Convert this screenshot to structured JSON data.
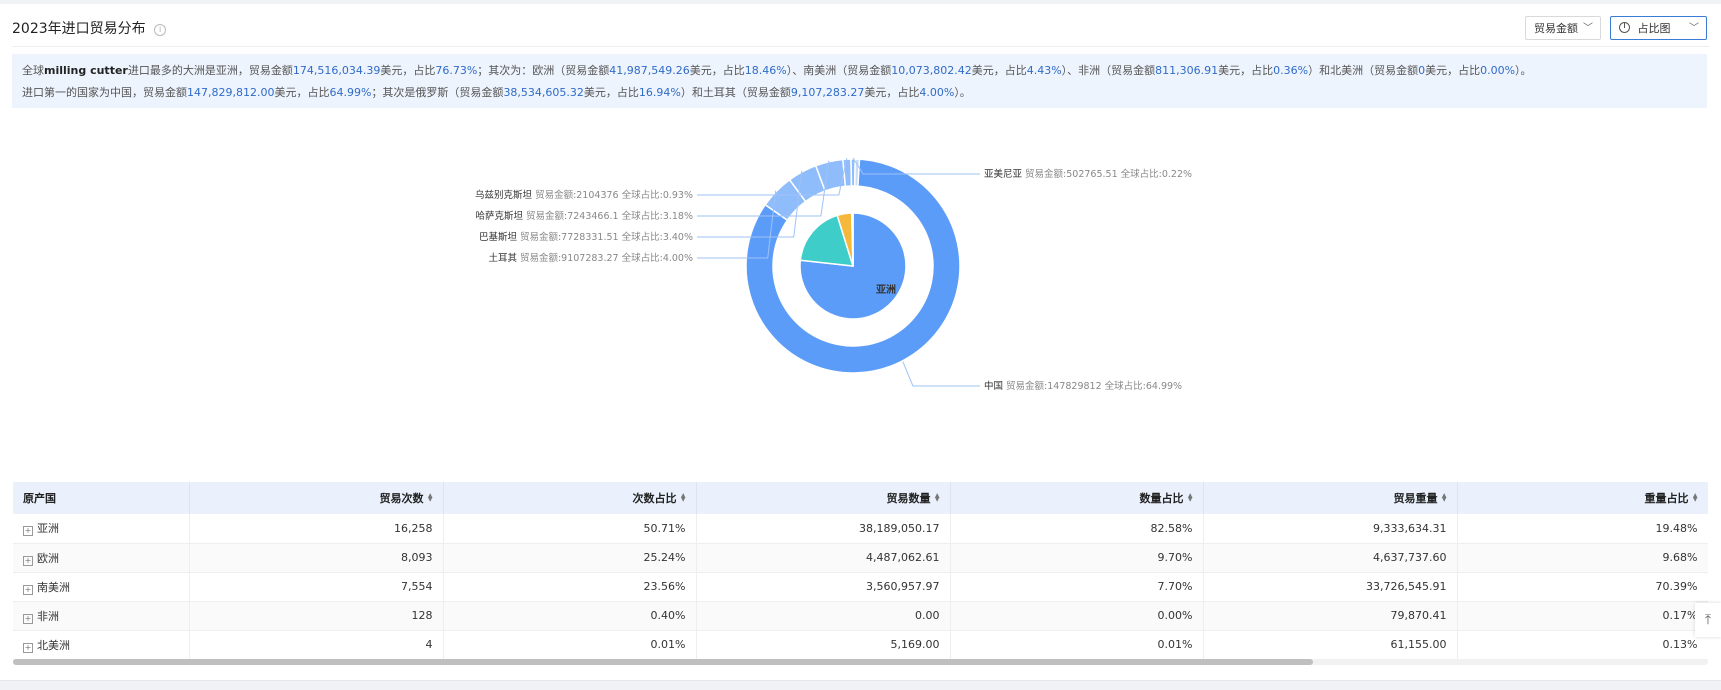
{
  "header": {
    "title": "2023年进口贸易分布",
    "metric_select": "贸易金额",
    "view_select": "占比图"
  },
  "summary": {
    "line1": [
      {
        "t": "全球",
        "c": ""
      },
      {
        "t": "milling cutter",
        "c": "b"
      },
      {
        "t": "进口最多的大洲是亚洲，贸易金额",
        "c": ""
      },
      {
        "t": "174,516,034.39",
        "c": "hl"
      },
      {
        "t": "美元，占比",
        "c": ""
      },
      {
        "t": "76.73%",
        "c": "hl"
      },
      {
        "t": "；其次为：欧洲（贸易金额",
        "c": ""
      },
      {
        "t": "41,987,549.26",
        "c": "hl"
      },
      {
        "t": "美元，占比",
        "c": ""
      },
      {
        "t": "18.46%",
        "c": "hl"
      },
      {
        "t": "）、南美洲（贸易金额",
        "c": ""
      },
      {
        "t": "10,073,802.42",
        "c": "hl"
      },
      {
        "t": "美元，占比",
        "c": ""
      },
      {
        "t": "4.43%",
        "c": "hl"
      },
      {
        "t": "）、非洲（贸易金额",
        "c": ""
      },
      {
        "t": "811,306.91",
        "c": "hl"
      },
      {
        "t": "美元，占比",
        "c": ""
      },
      {
        "t": "0.36%",
        "c": "hl"
      },
      {
        "t": "）和北美洲（贸易金额",
        "c": ""
      },
      {
        "t": "0",
        "c": "hl"
      },
      {
        "t": "美元，占比",
        "c": ""
      },
      {
        "t": "0.00%",
        "c": "hl"
      },
      {
        "t": "）。",
        "c": ""
      }
    ],
    "line2": [
      {
        "t": "进口第一的国家为中国，贸易金额",
        "c": ""
      },
      {
        "t": "147,829,812.00",
        "c": "hl"
      },
      {
        "t": "美元，占比",
        "c": ""
      },
      {
        "t": "64.99%",
        "c": "hl"
      },
      {
        "t": "；其次是俄罗斯（贸易金额",
        "c": ""
      },
      {
        "t": "38,534,605.32",
        "c": "hl"
      },
      {
        "t": "美元，占比",
        "c": ""
      },
      {
        "t": "16.94%",
        "c": "hl"
      },
      {
        "t": "）和土耳其（贸易金额",
        "c": ""
      },
      {
        "t": "9,107,283.27",
        "c": "hl"
      },
      {
        "t": "美元，占比",
        "c": ""
      },
      {
        "t": "4.00%",
        "c": "hl"
      },
      {
        "t": "）。",
        "c": ""
      }
    ]
  },
  "chart_data": {
    "type": "pie",
    "inner": {
      "center_label": "亚洲",
      "values": [
        76.73,
        18.46,
        4.43,
        0.36,
        0.02
      ],
      "colors": [
        "#5b9cf8",
        "#3ecdc8",
        "#f5b83a",
        "#e0604f",
        "#b264d0"
      ]
    },
    "outer": {
      "values": [
        64.99,
        4.0,
        3.4,
        3.18,
        0.93,
        0.22
      ],
      "color": "#5b9cf8",
      "rest_color": "#8fbcfb",
      "labels": [
        {
          "name": "中国",
          "amount_label": "贸易金额:",
          "amount": "147829812",
          "share_label": "全球占比:",
          "share": "64.99%"
        },
        {
          "name": "土耳其",
          "amount_label": "贸易金额:",
          "amount": "9107283.27",
          "share_label": "全球占比:",
          "share": "4.00%"
        },
        {
          "name": "巴基斯坦",
          "amount_label": "贸易金额:",
          "amount": "7728331.51",
          "share_label": "全球占比:",
          "share": "3.40%"
        },
        {
          "name": "哈萨克斯坦",
          "amount_label": "贸易金额:",
          "amount": "7243466.1",
          "share_label": "全球占比:",
          "share": "3.18%"
        },
        {
          "name": "乌兹别克斯坦",
          "amount_label": "贸易金额:",
          "amount": "2104376",
          "share_label": "全球占比:",
          "share": "0.93%"
        },
        {
          "name": "亚美尼亚",
          "amount_label": "贸易金额:",
          "amount": "502765.51",
          "share_label": "全球占比:",
          "share": "0.22%"
        }
      ]
    }
  },
  "table": {
    "columns": [
      "原产国",
      "贸易次数",
      "次数占比",
      "贸易数量",
      "数量占比",
      "贸易重量",
      "重量占比"
    ],
    "rows": [
      [
        "亚洲",
        "16,258",
        "50.71%",
        "38,189,050.17",
        "82.58%",
        "9,333,634.31",
        "19.48%"
      ],
      [
        "欧洲",
        "8,093",
        "25.24%",
        "4,487,062.61",
        "9.70%",
        "4,637,737.60",
        "9.68%"
      ],
      [
        "南美洲",
        "7,554",
        "23.56%",
        "3,560,957.97",
        "7.70%",
        "33,726,545.91",
        "70.39%"
      ],
      [
        "非洲",
        "128",
        "0.40%",
        "0.00",
        "0.00%",
        "79,870.41",
        "0.17%"
      ],
      [
        "北美洲",
        "4",
        "0.01%",
        "5,169.00",
        "0.01%",
        "61,155.00",
        "0.13%"
      ]
    ]
  }
}
